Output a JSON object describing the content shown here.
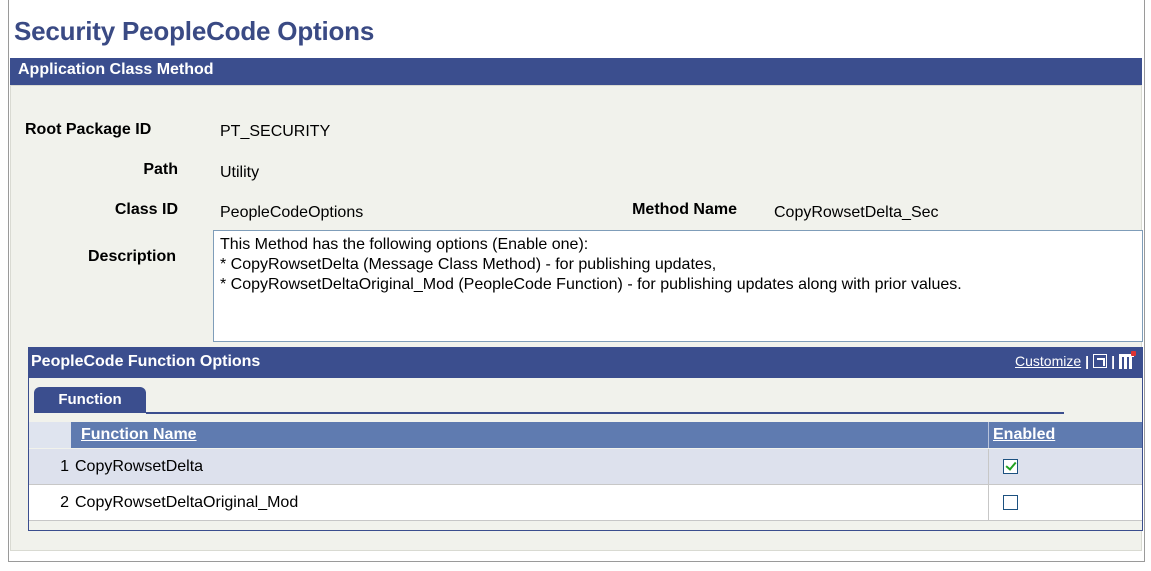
{
  "page": {
    "title": "Security PeopleCode Options",
    "section_title": "Application Class Method"
  },
  "form": {
    "root_package_label": "Root Package ID",
    "root_package_value": "PT_SECURITY",
    "path_label": "Path",
    "path_value": "Utility",
    "class_id_label": "Class ID",
    "class_id_value": "PeopleCodeOptions",
    "method_name_label": "Method Name",
    "method_name_value": "CopyRowsetDelta_Sec",
    "description_label": "Description",
    "description_lines": [
      "This Method has the following options (Enable one):",
      "* CopyRowsetDelta (Message Class Method) - for publishing updates,",
      "* CopyRowsetDeltaOriginal_Mod (PeopleCode Function) - for publishing updates along with prior values."
    ]
  },
  "grid": {
    "title": "PeopleCode Function Options",
    "customize_label": "Customize",
    "separator": "|",
    "tab_label": "Function",
    "columns": [
      "Function Name",
      "Enabled"
    ],
    "rows": [
      {
        "num": "1",
        "name": "CopyRowsetDelta",
        "enabled": true
      },
      {
        "num": "2",
        "name": "CopyRowsetDeltaOriginal_Mod",
        "enabled": false
      }
    ],
    "row_colors": [
      "#dde1ed",
      "#ffffff"
    ]
  },
  "icons": {
    "zoom": "new-window-icon",
    "download": "grid-download-icon",
    "checkbox_checked": "checkbox-checked-icon",
    "checkbox_unchecked": "checkbox-unchecked-icon"
  },
  "colors": {
    "header_bar": "#3b4e8e",
    "title": "#3a4a84",
    "panel_bg": "#f1f2ec",
    "column_header": "#5f7bb0"
  }
}
